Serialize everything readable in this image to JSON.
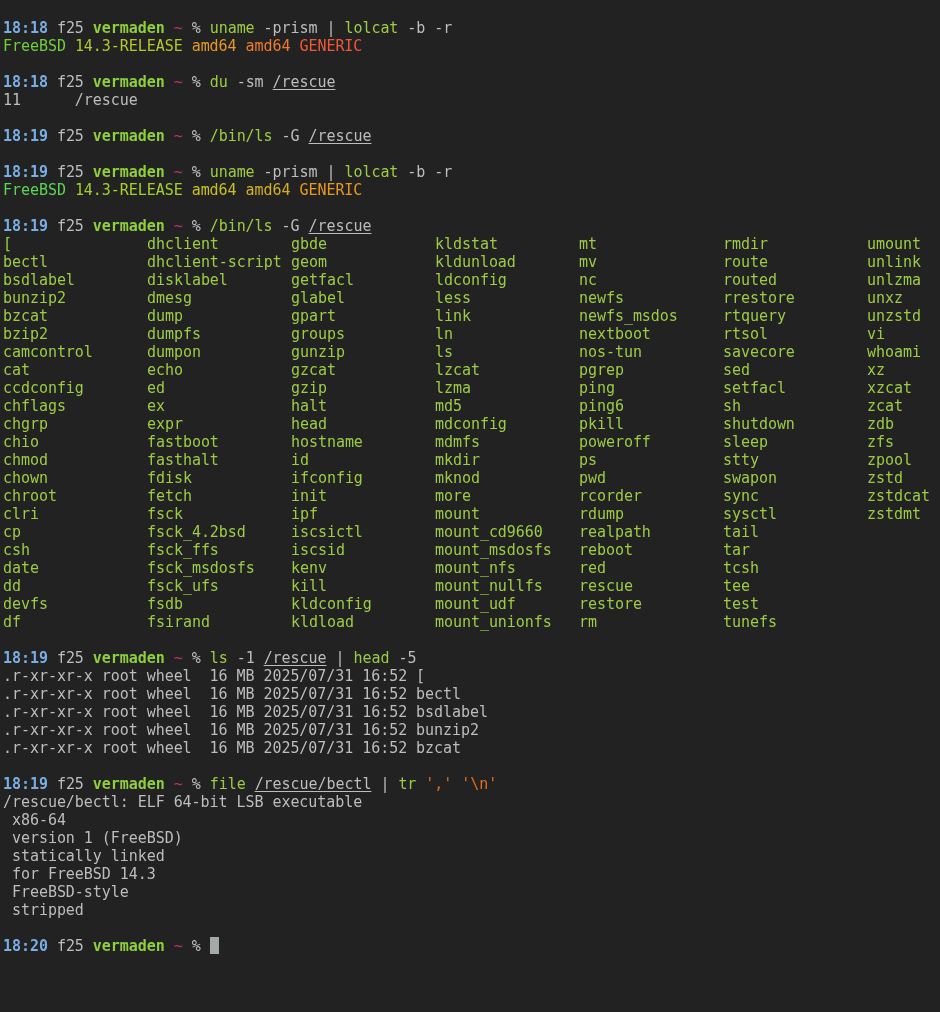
{
  "terminal": {
    "lines": [
      {
        "kind": "text",
        "segments": [
          {
            "kind": "time",
            "text": "18:18"
          },
          {
            "kind": "host",
            "text": "f25"
          },
          {
            "kind": "user",
            "text": "vermaden"
          },
          {
            "kind": "tilde",
            "text": "~"
          },
          {
            "kind": "sign",
            "text": "%"
          },
          {
            "kind": "cmd",
            "text": "uname"
          },
          {
            "kind": "arg",
            "text": "-prism"
          },
          {
            "kind": "arg",
            "text": "|"
          },
          {
            "kind": "cmd",
            "text": "lolcat"
          },
          {
            "kind": "arg",
            "text": "-b"
          },
          {
            "kind": "arg",
            "text": "-r"
          }
        ]
      },
      {
        "kind": "text",
        "segments": [
          {
            "kind": "lolcat",
            "text": "FreeBSD",
            "color": "#6fd03c"
          },
          {
            "kind": "lolcat",
            "text": "14.3-RELEASE",
            "color": "#b4c82a"
          },
          {
            "kind": "lolcat",
            "text": "amd64",
            "color": "#e59a22"
          },
          {
            "kind": "lolcat",
            "text": "amd64",
            "color": "#ef7a2c"
          },
          {
            "kind": "lolcat",
            "text": "GENERIC",
            "color": "#f0583a"
          }
        ]
      },
      {
        "kind": "blank"
      },
      {
        "kind": "text",
        "segments": [
          {
            "kind": "time",
            "text": "18:18"
          },
          {
            "kind": "host",
            "text": "f25"
          },
          {
            "kind": "user",
            "text": "vermaden"
          },
          {
            "kind": "tilde",
            "text": "~"
          },
          {
            "kind": "sign",
            "text": "%"
          },
          {
            "kind": "cmd",
            "text": "du"
          },
          {
            "kind": "arg",
            "text": "-sm"
          },
          {
            "kind": "path",
            "text": "/rescue"
          }
        ]
      },
      {
        "kind": "text",
        "segments": [
          {
            "kind": "out",
            "text": "11      /rescue"
          }
        ]
      },
      {
        "kind": "blank"
      },
      {
        "kind": "text",
        "segments": [
          {
            "kind": "time",
            "text": "18:19"
          },
          {
            "kind": "host",
            "text": "f25"
          },
          {
            "kind": "user",
            "text": "vermaden"
          },
          {
            "kind": "tilde",
            "text": "~"
          },
          {
            "kind": "sign",
            "text": "%"
          },
          {
            "kind": "cmd",
            "text": "/bin/ls"
          },
          {
            "kind": "arg",
            "text": "-G"
          },
          {
            "kind": "path",
            "text": "/rescue"
          }
        ]
      },
      {
        "kind": "blank"
      },
      {
        "kind": "text",
        "segments": [
          {
            "kind": "time",
            "text": "18:19"
          },
          {
            "kind": "host",
            "text": "f25"
          },
          {
            "kind": "user",
            "text": "vermaden"
          },
          {
            "kind": "tilde",
            "text": "~"
          },
          {
            "kind": "sign",
            "text": "%"
          },
          {
            "kind": "cmd",
            "text": "uname"
          },
          {
            "kind": "arg",
            "text": "-prism"
          },
          {
            "kind": "arg",
            "text": "|"
          },
          {
            "kind": "cmd",
            "text": "lolcat"
          },
          {
            "kind": "arg",
            "text": "-b"
          },
          {
            "kind": "arg",
            "text": "-r"
          }
        ]
      },
      {
        "kind": "text",
        "segments": [
          {
            "kind": "lolcat",
            "text": "FreeBSD",
            "color": "#5cd655"
          },
          {
            "kind": "lolcat",
            "text": "14.3-RELEASE",
            "color": "#a3cf2e"
          },
          {
            "kind": "lolcat",
            "text": "amd64",
            "color": "#c8c21e"
          },
          {
            "kind": "lolcat",
            "text": "amd64",
            "color": "#d4b020"
          },
          {
            "kind": "lolcat",
            "text": "GENERIC",
            "color": "#e49a20"
          }
        ]
      },
      {
        "kind": "blank"
      },
      {
        "kind": "text",
        "segments": [
          {
            "kind": "time",
            "text": "18:19"
          },
          {
            "kind": "host",
            "text": "f25"
          },
          {
            "kind": "user",
            "text": "vermaden"
          },
          {
            "kind": "tilde",
            "text": "~"
          },
          {
            "kind": "sign",
            "text": "%"
          },
          {
            "kind": "cmd",
            "text": "/bin/ls"
          },
          {
            "kind": "arg",
            "text": "-G"
          },
          {
            "kind": "path",
            "text": "/rescue"
          }
        ]
      },
      {
        "kind": "listing",
        "columns": [
          [
            "[",
            "bectl",
            "bsdlabel",
            "bunzip2",
            "bzcat",
            "bzip2",
            "camcontrol",
            "cat",
            "ccdconfig",
            "chflags",
            "chgrp",
            "chio",
            "chmod",
            "chown",
            "chroot",
            "clri",
            "cp",
            "csh",
            "date",
            "dd",
            "devfs",
            "df"
          ],
          [
            "dhclient",
            "dhclient-script",
            "disklabel",
            "dmesg",
            "dump",
            "dumpfs",
            "dumpon",
            "echo",
            "ed",
            "ex",
            "expr",
            "fastboot",
            "fasthalt",
            "fdisk",
            "fetch",
            "fsck",
            "fsck_4.2bsd",
            "fsck_ffs",
            "fsck_msdosfs",
            "fsck_ufs",
            "fsdb",
            "fsirand"
          ],
          [
            "gbde",
            "geom",
            "getfacl",
            "glabel",
            "gpart",
            "groups",
            "gunzip",
            "gzcat",
            "gzip",
            "halt",
            "head",
            "hostname",
            "id",
            "ifconfig",
            "init",
            "ipf",
            "iscsictl",
            "iscsid",
            "kenv",
            "kill",
            "kldconfig",
            "kldload"
          ],
          [
            "kldstat",
            "kldunload",
            "ldconfig",
            "less",
            "link",
            "ln",
            "ls",
            "lzcat",
            "lzma",
            "md5",
            "mdconfig",
            "mdmfs",
            "mkdir",
            "mknod",
            "more",
            "mount",
            "mount_cd9660",
            "mount_msdosfs",
            "mount_nfs",
            "mount_nullfs",
            "mount_udf",
            "mount_unionfs"
          ],
          [
            "mt",
            "mv",
            "nc",
            "newfs",
            "newfs_msdos",
            "nextboot",
            "nos-tun",
            "pgrep",
            "ping",
            "ping6",
            "pkill",
            "poweroff",
            "ps",
            "pwd",
            "rcorder",
            "rdump",
            "realpath",
            "reboot",
            "red",
            "rescue",
            "restore",
            "rm"
          ],
          [
            "rmdir",
            "route",
            "routed",
            "rrestore",
            "rtquery",
            "rtsol",
            "savecore",
            "sed",
            "setfacl",
            "sh",
            "shutdown",
            "sleep",
            "stty",
            "swapon",
            "sync",
            "sysctl",
            "tail",
            "tar",
            "tcsh",
            "tee",
            "test",
            "tunefs"
          ],
          [
            "umount",
            "unlink",
            "unlzma",
            "unxz",
            "unzstd",
            "vi",
            "whoami",
            "xz",
            "xzcat",
            "zcat",
            "zdb",
            "zfs",
            "zpool",
            "zstd",
            "zstdcat",
            "zstdmt"
          ]
        ]
      },
      {
        "kind": "blank"
      },
      {
        "kind": "text",
        "segments": [
          {
            "kind": "time",
            "text": "18:19"
          },
          {
            "kind": "host",
            "text": "f25"
          },
          {
            "kind": "user",
            "text": "vermaden"
          },
          {
            "kind": "tilde",
            "text": "~"
          },
          {
            "kind": "sign",
            "text": "%"
          },
          {
            "kind": "cmd",
            "text": "ls"
          },
          {
            "kind": "arg",
            "text": "-1"
          },
          {
            "kind": "path",
            "text": "/rescue"
          },
          {
            "kind": "arg",
            "text": "|"
          },
          {
            "kind": "cmd",
            "text": "head"
          },
          {
            "kind": "arg",
            "text": "-5"
          }
        ]
      },
      {
        "kind": "text",
        "segments": [
          {
            "kind": "out",
            "text": ".r-xr-xr-x root wheel  16 MB 2025/07/31 16:52 ["
          }
        ]
      },
      {
        "kind": "text",
        "segments": [
          {
            "kind": "out",
            "text": ".r-xr-xr-x root wheel  16 MB 2025/07/31 16:52 bectl"
          }
        ]
      },
      {
        "kind": "text",
        "segments": [
          {
            "kind": "out",
            "text": ".r-xr-xr-x root wheel  16 MB 2025/07/31 16:52 bsdlabel"
          }
        ]
      },
      {
        "kind": "text",
        "segments": [
          {
            "kind": "out",
            "text": ".r-xr-xr-x root wheel  16 MB 2025/07/31 16:52 bunzip2"
          }
        ]
      },
      {
        "kind": "text",
        "segments": [
          {
            "kind": "out",
            "text": ".r-xr-xr-x root wheel  16 MB 2025/07/31 16:52 bzcat"
          }
        ]
      },
      {
        "kind": "blank"
      },
      {
        "kind": "text",
        "segments": [
          {
            "kind": "time",
            "text": "18:19"
          },
          {
            "kind": "host",
            "text": "f25"
          },
          {
            "kind": "user",
            "text": "vermaden"
          },
          {
            "kind": "tilde",
            "text": "~"
          },
          {
            "kind": "sign",
            "text": "%"
          },
          {
            "kind": "cmd",
            "text": "file"
          },
          {
            "kind": "path",
            "text": "/rescue/bectl"
          },
          {
            "kind": "arg",
            "text": "|"
          },
          {
            "kind": "cmd",
            "text": "tr"
          },
          {
            "kind": "quote",
            "text": "','"
          },
          {
            "kind": "quote",
            "text": "'\\n'"
          }
        ]
      },
      {
        "kind": "text",
        "segments": [
          {
            "kind": "out",
            "text": "/rescue/bectl: ELF 64-bit LSB executable"
          }
        ]
      },
      {
        "kind": "text",
        "segments": [
          {
            "kind": "out",
            "text": " x86-64"
          }
        ]
      },
      {
        "kind": "text",
        "segments": [
          {
            "kind": "out",
            "text": " version 1 (FreeBSD)"
          }
        ]
      },
      {
        "kind": "text",
        "segments": [
          {
            "kind": "out",
            "text": " statically linked"
          }
        ]
      },
      {
        "kind": "text",
        "segments": [
          {
            "kind": "out",
            "text": " for FreeBSD 14.3"
          }
        ]
      },
      {
        "kind": "text",
        "segments": [
          {
            "kind": "out",
            "text": " FreeBSD-style"
          }
        ]
      },
      {
        "kind": "text",
        "segments": [
          {
            "kind": "out",
            "text": " stripped"
          }
        ]
      },
      {
        "kind": "blank"
      },
      {
        "kind": "text",
        "segments": [
          {
            "kind": "time",
            "text": "18:20"
          },
          {
            "kind": "host",
            "text": "f25"
          },
          {
            "kind": "user",
            "text": "vermaden"
          },
          {
            "kind": "tilde",
            "text": "~"
          },
          {
            "kind": "sign",
            "text": "%"
          },
          {
            "kind": "cursor"
          }
        ]
      }
    ]
  }
}
